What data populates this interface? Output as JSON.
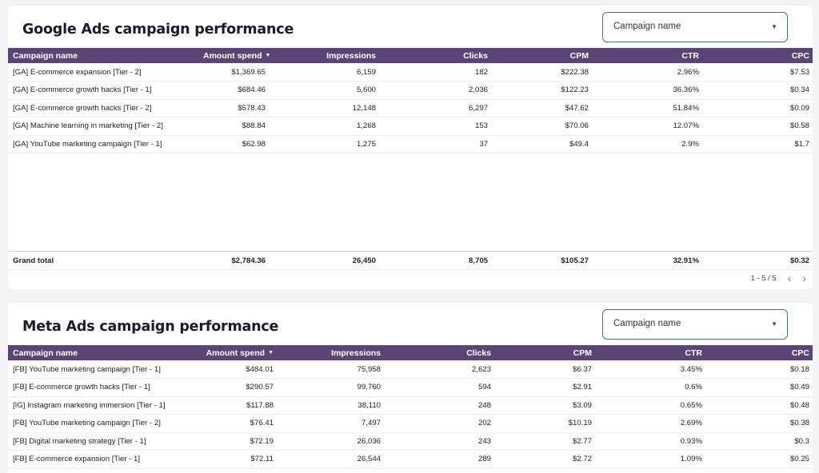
{
  "google": {
    "title": "Google Ads campaign performance",
    "dropdown_label": "Campaign name",
    "headers": [
      "Campaign name",
      "Amount spend",
      "Impressions",
      "Clicks",
      "CPM",
      "CTR",
      "CPC"
    ],
    "rows": [
      [
        "[GA] E-commerce expansion [Tier - 2]",
        "$1,369.65",
        "6,159",
        "182",
        "$222.38",
        "2.96%",
        "$7.53"
      ],
      [
        "[GA] E-commerce growth hacks [Tier - 1]",
        "$684.46",
        "5,600",
        "2,036",
        "$122.23",
        "36.36%",
        "$0.34"
      ],
      [
        "[GA] E-commerce growth hacks [Tier - 2]",
        "$578.43",
        "12,148",
        "6,297",
        "$47.62",
        "51.84%",
        "$0.09"
      ],
      [
        "[GA] Machine learning in marketing [Tier - 2]",
        "$88.84",
        "1,268",
        "153",
        "$70.06",
        "12.07%",
        "$0.58"
      ],
      [
        "[GA] YouTube marketing campaign [Tier - 1]",
        "$62.98",
        "1,275",
        "37",
        "$49.4",
        "2.9%",
        "$1.7"
      ]
    ],
    "total": [
      "Grand total",
      "$2,784.36",
      "26,450",
      "8,705",
      "$105.27",
      "32.91%",
      "$0.32"
    ],
    "pager": "1 - 5 / 5"
  },
  "meta": {
    "title": "Meta Ads campaign performance",
    "dropdown_label": "Campaign name",
    "headers": [
      "Campaign name",
      "Amount spend",
      "Impressions",
      "Clicks",
      "CPM",
      "CTR",
      "CPC"
    ],
    "rows": [
      [
        "[FB] YouTube marketing campaign [Tier - 1]",
        "$484.01",
        "75,958",
        "2,623",
        "$6.37",
        "3.45%",
        "$0.18"
      ],
      [
        "[FB] E-commerce growth hacks [Tier - 1]",
        "$290.57",
        "99,760",
        "594",
        "$2.91",
        "0.6%",
        "$0.49"
      ],
      [
        "[IG] Instagram marketing immersion [Tier - 1]",
        "$117.88",
        "38,110",
        "248",
        "$3.09",
        "0.65%",
        "$0.48"
      ],
      [
        "[FB] YouTube marketing campaign [Tier - 2]",
        "$76.41",
        "7,497",
        "202",
        "$10.19",
        "2.69%",
        "$0.38"
      ],
      [
        "[FB] Digital marketing strategy [Tier - 1]",
        "$72.19",
        "26,036",
        "243",
        "$2.77",
        "0.93%",
        "$0.3"
      ],
      [
        "[FB] E-commerce expansion [Tier - 1]",
        "$72.11",
        "26,544",
        "289",
        "$2.72",
        "1.09%",
        "$0.25"
      ]
    ]
  },
  "colors": {
    "header_bg": "#5b4577",
    "dropdown_border": "#4a6c8c",
    "title": "#1b1b2f"
  }
}
